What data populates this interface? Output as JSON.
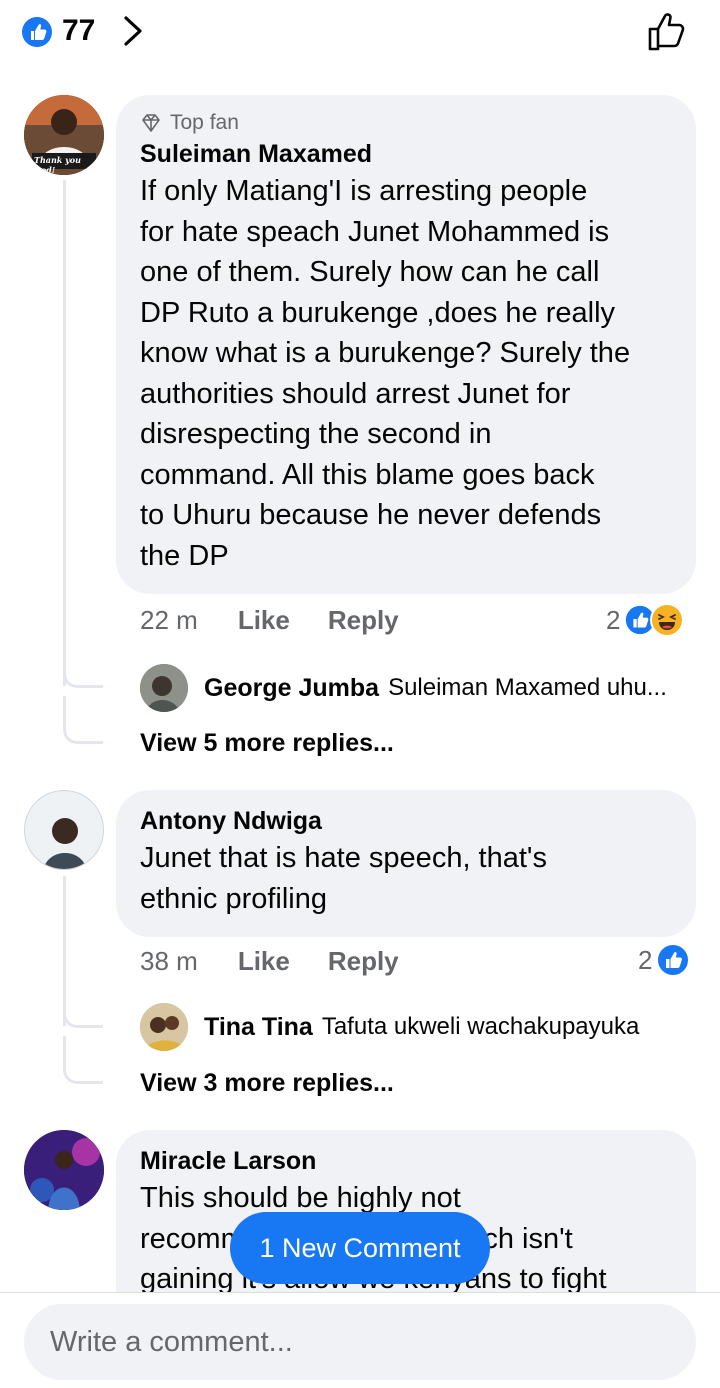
{
  "header": {
    "reaction_count": "77"
  },
  "comments": [
    {
      "badge": "Top fan",
      "author": "Suleiman Maxamed",
      "lines": [
        "If only Matiang'I is arresting people",
        "for hate speach Junet Mohammed is",
        "one of them. Surely how can he call",
        "DP Ruto a burukenge ,does he really",
        "know what is a burukenge? Surely the",
        "authorities should arrest Junet for",
        "disrespecting the second in",
        "command. All this blame goes back",
        "to Uhuru because he never defends",
        "the DP"
      ],
      "time": "22 m",
      "like_label": "Like",
      "reply_label": "Reply",
      "reactions": "2",
      "reply_preview": {
        "name": "George Jumba",
        "snippet": "Suleiman Maxamed uhu..."
      },
      "more_replies": "View 5 more replies..."
    },
    {
      "author": "Antony Ndwiga",
      "lines": [
        "Junet that is hate speech,  that's",
        "ethnic profiling"
      ],
      "time": "38 m",
      "like_label": "Like",
      "reply_label": "Reply",
      "reactions": "2",
      "reply_preview": {
        "name": "Tina Tina",
        "snippet": "Tafuta ukweli wachakupayuka"
      },
      "more_replies": "View 3 more replies..."
    },
    {
      "author": "Miracle Larson",
      "lines": [
        "This should be highly not",
        "recommended if hate speech isn't",
        "gaining it's allow we kenyans to fight"
      ]
    }
  ],
  "toast": {
    "label": "1 New Comment"
  },
  "composer": {
    "placeholder": "Write a comment..."
  },
  "avatar_texts": {
    "suleiman_caption": "Thank you God!"
  },
  "colors": {
    "accent": "#1877f2",
    "bubble": "#f0f2f5",
    "muted": "#65676b",
    "haha": "#f7b125"
  }
}
